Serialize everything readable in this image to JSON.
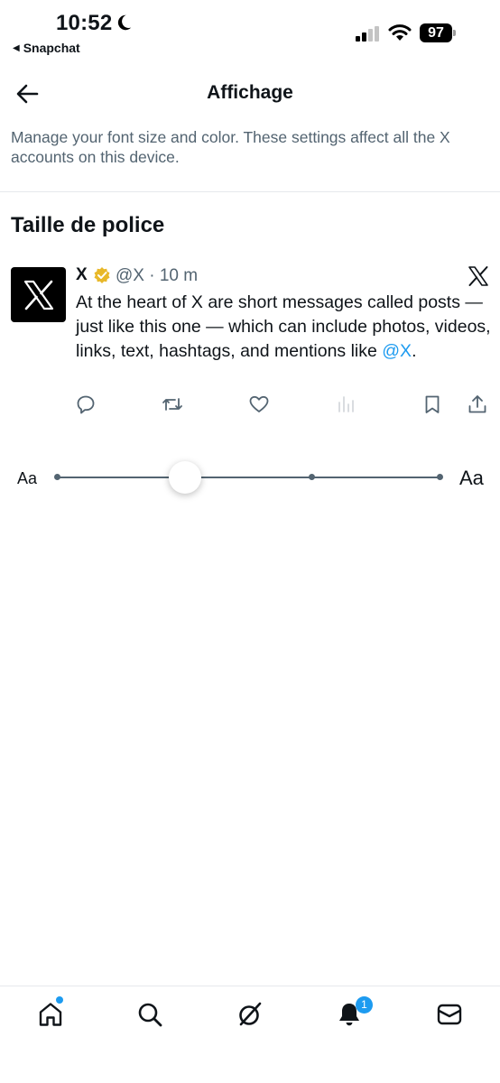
{
  "status_bar": {
    "time": "10:52",
    "back_app": "Snapchat",
    "battery": "97"
  },
  "header": {
    "title": "Affichage",
    "description": "Manage your font size and color. These settings affect all the X accounts on this device."
  },
  "section": {
    "title": "Taille de police"
  },
  "post": {
    "name": "X",
    "meta": "@X · 10 m",
    "text": "At the heart of X are short messages called posts — just like this one — which can include photos, videos, links, text, hashtags, and mentions like ",
    "mention": "@X",
    "text_end": "."
  },
  "slider": {
    "label_small": "Aa",
    "label_large": "Aa",
    "steps": 4,
    "value_step": 2
  },
  "nav": {
    "notifications_badge": "1"
  },
  "colors": {
    "accent": "#1d9bf0",
    "text_secondary": "#536471",
    "verified_gold": "#e8b829"
  }
}
